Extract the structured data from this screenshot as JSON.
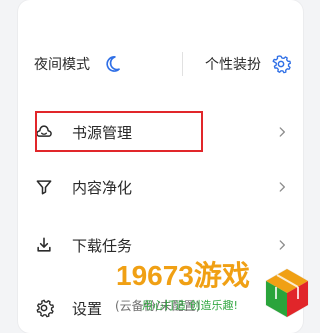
{
  "top": {
    "night_mode_label": "夜间模式",
    "personalize_label": "个性装扮"
  },
  "menu": {
    "items": [
      {
        "label": "书源管理"
      },
      {
        "label": "内容净化"
      },
      {
        "label": "下载任务"
      },
      {
        "label": "设置"
      }
    ],
    "settings_sub": "(云备份/未配置)"
  },
  "watermark": {
    "big": "19673游戏",
    "small": "用心打造 创造乐趣!"
  },
  "colors": {
    "accent_blue": "#2f6fe6",
    "highlight_red": "#e1262a"
  },
  "icons": {
    "night_mode": "moon-icon",
    "personalize": "gear-icon",
    "book_source": "book-source-icon",
    "purify": "filter-icon",
    "download": "download-icon",
    "settings": "settings-gear-icon",
    "chevron": "chevron-right-icon"
  }
}
